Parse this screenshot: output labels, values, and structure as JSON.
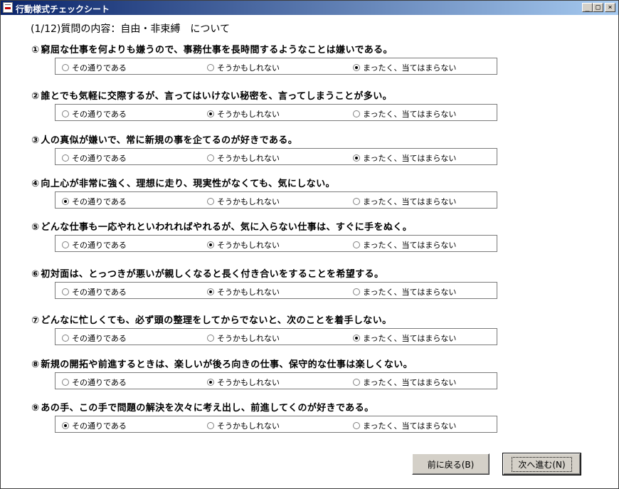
{
  "window": {
    "title": "行動様式チェックシート",
    "controls": {
      "minimize": "_",
      "maximize": "□",
      "close": "×"
    }
  },
  "header": "(1/12)質問の内容：自由・非束縛　について",
  "options": [
    "その通りである",
    "そうかもしれない",
    "まったく、当てはまらない"
  ],
  "questions": [
    {
      "num": "①",
      "text": "窮屈な仕事を何よりも嫌うので、事務仕事を長時間するようなことは嫌いである。",
      "selected": 2
    },
    {
      "num": "②",
      "text": "誰とでも気軽に交際するが、言ってはいけない秘密を、言ってしまうことが多い。",
      "selected": 1
    },
    {
      "num": "③",
      "text": "人の真似が嫌いで、常に新規の事を企てるのが好きである。",
      "selected": 2
    },
    {
      "num": "④",
      "text": "向上心が非常に強く、理想に走り、現実性がなくても、気にしない。",
      "selected": 0
    },
    {
      "num": "⑤",
      "text": "どんな仕事も一応やれといわれればやれるが、気に入らない仕事は、すぐに手をぬく。",
      "selected": 1
    },
    {
      "num": "⑥",
      "text": "初対面は、とっつきが悪いが親しくなると長く付き合いをすることを希望する。",
      "selected": 1
    },
    {
      "num": "⑦",
      "text": "どんなに忙しくても、必ず頭の整理をしてからでないと、次のことを着手しない。",
      "selected": 2
    },
    {
      "num": "⑧",
      "text": "新規の開拓や前進するときは、楽しいが後ろ向きの仕事、保守的な仕事は楽しくない。",
      "selected": 1
    },
    {
      "num": "⑨",
      "text": "あの手、この手で問題の解決を次々に考え出し、前進してくのが好きである。",
      "selected": 0
    }
  ],
  "buttons": {
    "back": "前に戻る(B)",
    "next": "次へ進む(N)"
  }
}
